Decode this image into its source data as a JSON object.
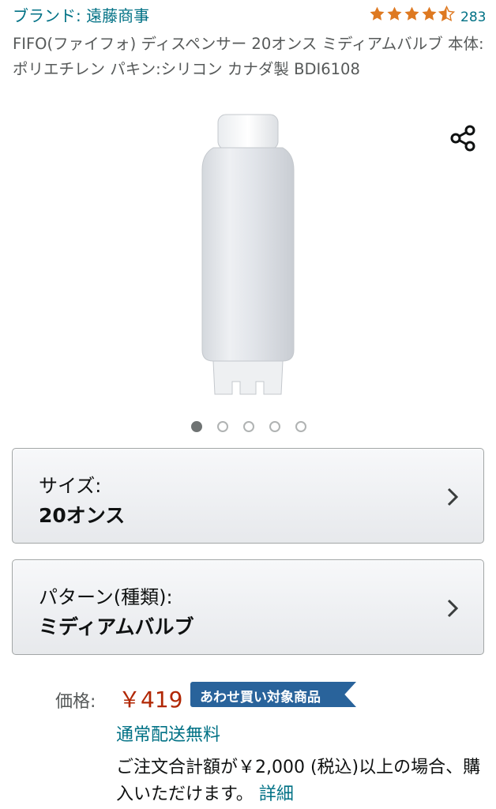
{
  "brand": {
    "link_text": "ブランド: 遠藤商事"
  },
  "rating": {
    "stars": 4.5,
    "count": "283",
    "star_color": "#de7921"
  },
  "product": {
    "title": "FIFO(ファイフォ) ディスペンサー 20オンス ミディアムバルブ 本体:ポリエチレン パキン:シリコン カナダ製 BDI6108"
  },
  "share": {
    "icon": "share-icon"
  },
  "carousel": {
    "count": 5,
    "active_index": 0
  },
  "variations": [
    {
      "label": "サイズ:",
      "value": "20オンス"
    },
    {
      "label": "パターン(種類):",
      "value": "ミディアムバルブ"
    }
  ],
  "price": {
    "label": "価格:",
    "value": "￥419",
    "badge": "あわせ買い対象商品",
    "color": "#b12704"
  },
  "shipping": {
    "title": "通常配送無料",
    "note": "ご注文合計額が￥2,000 (税込)以上の場合、購入いただけます。",
    "detail_link": "詳細"
  }
}
